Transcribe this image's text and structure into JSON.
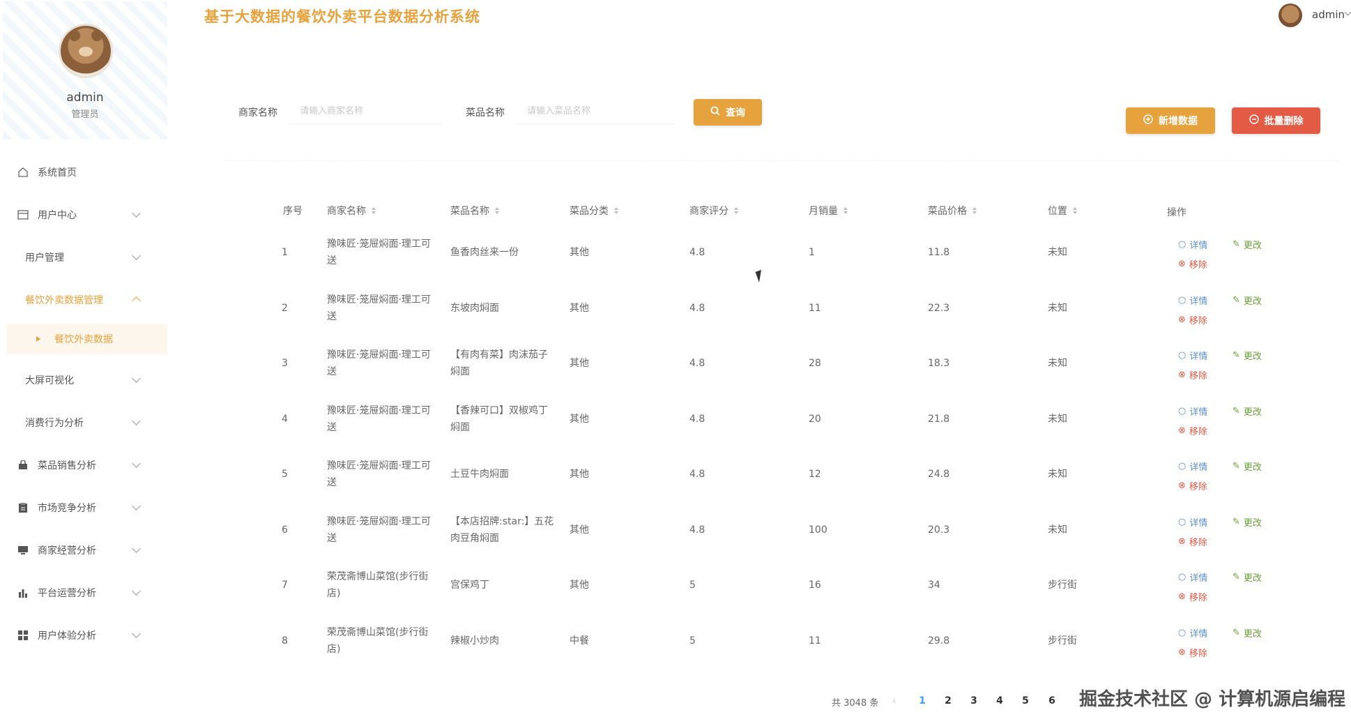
{
  "header": {
    "title": "基于大数据的餐饮外卖平台数据分析系统",
    "user_name": "admin"
  },
  "profile": {
    "name": "admin",
    "role": "管理员"
  },
  "sidebar": {
    "items": [
      {
        "label": "系统首页",
        "icon": "home-icon"
      },
      {
        "label": "用户中心",
        "icon": "card-icon"
      },
      {
        "label": "用户管理"
      },
      {
        "label": "餐饮外卖数据管理"
      },
      {
        "label": "餐饮外卖数据"
      },
      {
        "label": "大屏可视化"
      },
      {
        "label": "消费行为分析"
      },
      {
        "label": "菜品销售分析",
        "icon": "bag-icon"
      },
      {
        "label": "市场竞争分析",
        "icon": "clipboard-icon"
      },
      {
        "label": "商家经营分析",
        "icon": "monitor-icon"
      },
      {
        "label": "平台运营分析",
        "icon": "bar-chart-icon"
      },
      {
        "label": "用户体验分析",
        "icon": "grid-icon"
      }
    ]
  },
  "search": {
    "merchant_label": "商家名称",
    "merchant_placeholder": "请输入商家名称",
    "dish_label": "菜品名称",
    "dish_placeholder": "请输入菜品名称",
    "search_button": "查询"
  },
  "actions": {
    "add_button": "新增数据",
    "batch_delete_button": "批量删除"
  },
  "table": {
    "headers": [
      "序号",
      "商家名称",
      "菜品名称",
      "菜品分类",
      "商家评分",
      "月销量",
      "菜品价格",
      "位置",
      "操作"
    ],
    "ops": {
      "detail": "详情",
      "edit": "更改",
      "remove": "移除"
    },
    "rows": [
      {
        "no": "1",
        "merchant": "豫味匠·笼屉焖面·理工可送",
        "dish": "鱼香肉丝来一份",
        "category": "其他",
        "rating": "4.8",
        "sales": "1",
        "price": "11.8",
        "location": "未知"
      },
      {
        "no": "2",
        "merchant": "豫味匠·笼屉焖面·理工可送",
        "dish": "东坡肉焖面",
        "category": "其他",
        "rating": "4.8",
        "sales": "11",
        "price": "22.3",
        "location": "未知"
      },
      {
        "no": "3",
        "merchant": "豫味匠·笼屉焖面·理工可送",
        "dish": "【有肉有菜】肉沫茄子焖面",
        "category": "其他",
        "rating": "4.8",
        "sales": "28",
        "price": "18.3",
        "location": "未知"
      },
      {
        "no": "4",
        "merchant": "豫味匠·笼屉焖面·理工可送",
        "dish": "【香辣可口】双椒鸡丁焖面",
        "category": "其他",
        "rating": "4.8",
        "sales": "20",
        "price": "21.8",
        "location": "未知"
      },
      {
        "no": "5",
        "merchant": "豫味匠·笼屉焖面·理工可送",
        "dish": "土豆牛肉焖面",
        "category": "其他",
        "rating": "4.8",
        "sales": "12",
        "price": "24.8",
        "location": "未知"
      },
      {
        "no": "6",
        "merchant": "豫味匠·笼屉焖面·理工可送",
        "dish": "【本店招牌:star:】五花肉豆角焖面",
        "category": "其他",
        "rating": "4.8",
        "sales": "100",
        "price": "20.3",
        "location": "未知"
      },
      {
        "no": "7",
        "merchant": "荣茂斋博山菜馆(步行街店)",
        "dish": "宫保鸡丁",
        "category": "其他",
        "rating": "5",
        "sales": "16",
        "price": "34",
        "location": "步行街"
      },
      {
        "no": "8",
        "merchant": "荣茂斋博山菜馆(步行街店)",
        "dish": "辣椒小炒肉",
        "category": "中餐",
        "rating": "5",
        "sales": "11",
        "price": "29.8",
        "location": "步行街"
      }
    ]
  },
  "pagination": {
    "total": "共 3048 条",
    "pages": [
      "1",
      "2",
      "3",
      "4",
      "5",
      "6"
    ],
    "current": "1"
  },
  "watermark": "掘金技术社区 @ 计算机源启编程",
  "colors": {
    "accent": "#e6a23c",
    "danger": "#e35b45",
    "link": "#5b8fc9",
    "edit": "#6a9e3a"
  }
}
